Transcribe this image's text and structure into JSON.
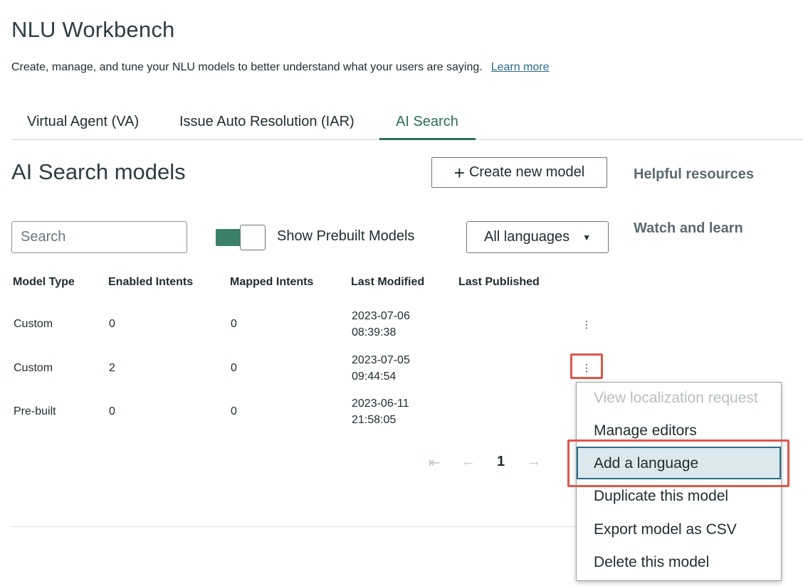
{
  "page": {
    "title": "NLU Workbench",
    "subtitle": "Create, manage, and tune your NLU models to better understand what your users are saying.",
    "learn_more": "Learn more"
  },
  "tabs": [
    {
      "label": "Virtual Agent (VA)",
      "active": false
    },
    {
      "label": "Issue Auto Resolution (IAR)",
      "active": false
    },
    {
      "label": "AI Search",
      "active": true
    }
  ],
  "section": {
    "heading": "AI Search models",
    "create_button": "Create new model",
    "helpful_resources": "Helpful resources",
    "watch_and_learn": "Watch and learn"
  },
  "filters": {
    "search_placeholder": "Search",
    "toggle_label": "Show Prebuilt Models",
    "toggle_on": true,
    "language_selected": "All languages"
  },
  "table": {
    "headers": [
      "Model Type",
      "Enabled Intents",
      "Mapped Intents",
      "Last Modified",
      "Last Published"
    ],
    "rows": [
      {
        "type": "Custom",
        "enabled": "0",
        "mapped": "0",
        "modified_date": "2023-07-06",
        "modified_time": "08:39:38",
        "published": ""
      },
      {
        "type": "Custom",
        "enabled": "2",
        "mapped": "0",
        "modified_date": "2023-07-05",
        "modified_time": "09:44:54",
        "published": ""
      },
      {
        "type": "Pre-built",
        "enabled": "0",
        "mapped": "0",
        "modified_date": "2023-06-11",
        "modified_time": "21:58:05",
        "published": ""
      }
    ]
  },
  "pagination": {
    "current_page": "1",
    "first_icon": "⇤",
    "prev_icon": "←",
    "next_icon": "→"
  },
  "context_menu": {
    "items": [
      {
        "label": "View localization request",
        "disabled": true
      },
      {
        "label": "Manage editors",
        "disabled": false
      },
      {
        "label": "Add a language",
        "disabled": false,
        "highlighted": true
      },
      {
        "label": "Duplicate this model",
        "disabled": false
      },
      {
        "label": "Export model as CSV",
        "disabled": false
      },
      {
        "label": "Delete this model",
        "disabled": false
      }
    ]
  },
  "colors": {
    "accent_green": "#2c6e55",
    "toggle_green": "#3b8068",
    "link_blue": "#2e6b8a",
    "annotation_red": "#e0574a",
    "menu_hover": "#dbe9ee"
  }
}
